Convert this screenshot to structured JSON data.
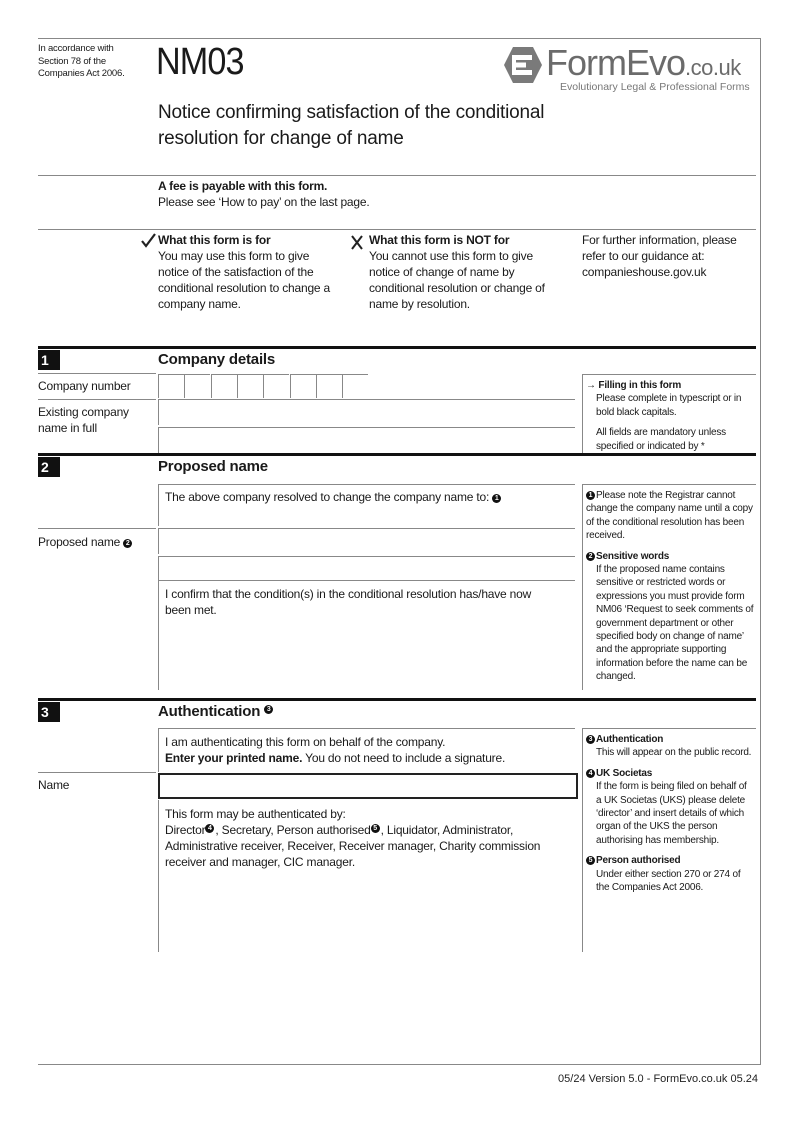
{
  "header": {
    "statute_note": [
      "In accordance with",
      "Section 78 of the",
      "Companies Act 2006."
    ],
    "form_code": "NM03",
    "title_lines": [
      "Notice confirming satisfaction of the conditional",
      "resolution for change of name"
    ],
    "logo": {
      "brand": "FormEvo",
      "domain": ".co.uk",
      "tagline": "Evolutionary Legal & Professional Forms",
      "icon": "formevo-hexagon-logo-icon"
    }
  },
  "fee": {
    "title": "A fee is payable with this form.",
    "text": "Please see ‘How to pay’ on the last page."
  },
  "intro": {
    "for": {
      "icon": "checkmark-icon",
      "title": "What this form is for",
      "text": "You may use this form to give notice of the satisfaction of the conditional resolution to change a company name."
    },
    "not_for": {
      "icon": "cross-icon",
      "title": "What this form is NOT for",
      "text": "You cannot use this form to give notice of change of name by conditional resolution or change of name by resolution."
    },
    "info": "For further information, please refer to our guidance at: companieshouse.gov.uk"
  },
  "section1": {
    "number": "1",
    "title": "Company details",
    "company_number_label": "Company number",
    "company_number_digits": 8,
    "company_number_value": "",
    "existing_name_label": "Existing company name in full",
    "existing_name_value_line1": "",
    "existing_name_value_line2": "",
    "note": {
      "icon": "arrow-right-icon",
      "title": "Filling in this form",
      "text1": "Please complete in typescript or in bold black capitals.",
      "text2": "All fields are mandatory unless specified or indicated by *"
    }
  },
  "section2": {
    "number": "2",
    "title": "Proposed name",
    "resolved_text": "The above company resolved to change the company name to:",
    "resolved_marker": "1",
    "proposed_label": "Proposed name",
    "proposed_marker": "2",
    "proposed_value_line1": "",
    "proposed_value_line2": "",
    "confirm_text": "I confirm that the condition(s) in the conditional resolution has/have now been met.",
    "notes": [
      {
        "marker": "1",
        "title": "",
        "text": "Please note the Registrar cannot change the company name until a copy of the conditional resolution has been received."
      },
      {
        "marker": "2",
        "title": "Sensitive words",
        "text": "If the proposed name contains sensitive or restricted words or expressions you must provide form NM06 ‘Request to seek comments of government department or other specified body on change of name’ and the appropriate supporting information before the name can be changed."
      }
    ]
  },
  "section3": {
    "number": "3",
    "title": "Authentication",
    "title_marker": "3",
    "behalf_text": "I am authenticating this form on behalf of the company.",
    "enter_bold": "Enter your printed name.",
    "enter_rest": " You do not need to include a signature.",
    "name_label": "Name",
    "name_value": "",
    "may_be_text": "This form may be authenticated by:",
    "director": "Director",
    "director_marker": "4",
    "mid": ", Secretary, Person authorised",
    "person_marker": "5",
    "rest": ", Liquidator, Administrator, Administrative receiver, Receiver, Receiver manager, Charity commission receiver and manager, CIC manager.",
    "notes": [
      {
        "marker": "3",
        "title": "Authentication",
        "text": "This will appear on the public record."
      },
      {
        "marker": "4",
        "title": "UK Societas",
        "text": "If the form is being filed on behalf of a UK Societas (UKS) please delete ‘director’ and insert details of which organ of the UKS the person authorising has membership."
      },
      {
        "marker": "5",
        "title": "Person authorised",
        "text": "Under either section 270 or 274 of the Companies Act 2006."
      }
    ]
  },
  "footer": {
    "version": "05/24 Version 5.0 - FormEvo.co.uk 05.24"
  }
}
